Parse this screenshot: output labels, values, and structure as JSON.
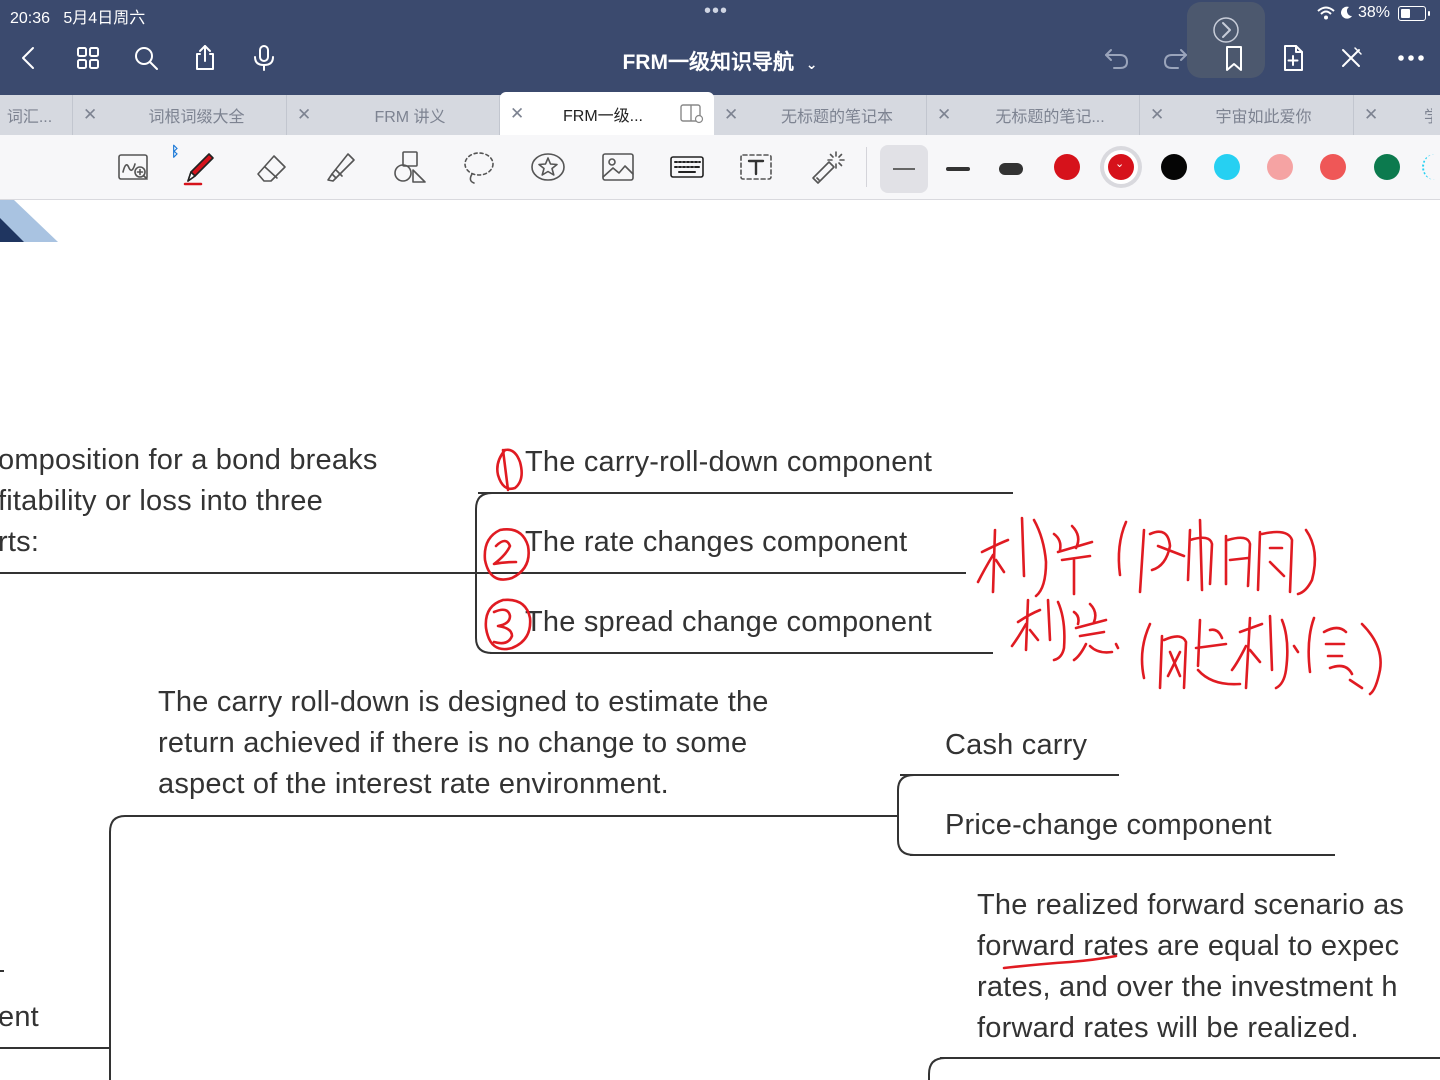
{
  "status_bar": {
    "time": "20:36",
    "date": "5月4日周六",
    "battery": "38%"
  },
  "nav": {
    "title": "FRM一级知识导航"
  },
  "tabs": [
    {
      "label": "词汇..."
    },
    {
      "label": "词根词缀大全"
    },
    {
      "label": "FRM 讲义"
    },
    {
      "label": "FRM一级..."
    },
    {
      "label": "无标题的笔记本"
    },
    {
      "label": "无标题的笔记..."
    },
    {
      "label": "宇宙如此爱你"
    },
    {
      "label": "学"
    }
  ],
  "tools": [
    "scan-icon",
    "pen-icon",
    "eraser-icon",
    "highlighter-icon",
    "shapes-icon",
    "lasso-icon",
    "sticker-icon",
    "image-icon",
    "keyboard-icon",
    "text-box-icon",
    "laser-pointer-icon"
  ],
  "colors": {
    "header_bg": "#3b4a6e",
    "tab_bg": "#d6d9e0",
    "ink_red": "#e01b22",
    "swatches": [
      "#d6121b",
      "#d6121b",
      "#050505",
      "#26d0f2",
      "#f5a3a3",
      "#ef5757",
      "#0c7a4e"
    ]
  },
  "mindmap": {
    "intro_lines": [
      "omposition for a bond breaks",
      "fitability or loss into three",
      "rts:"
    ],
    "components": [
      "The carry-roll-down component",
      "The rate changes component",
      "The spread change component"
    ],
    "carry_desc_lines": [
      "The carry roll-down is designed to estimate the",
      "return achieved if there is no change to some",
      "aspect of the interest rate environment."
    ],
    "sub_components": [
      "Cash carry",
      "Price-change component"
    ],
    "forward_desc_lines": [
      "The realized forward scenario as",
      "forward rates are equal to expec",
      "rates, and over the investment h",
      "forward rates will be realized."
    ],
    "partial_left_label": "ent"
  }
}
